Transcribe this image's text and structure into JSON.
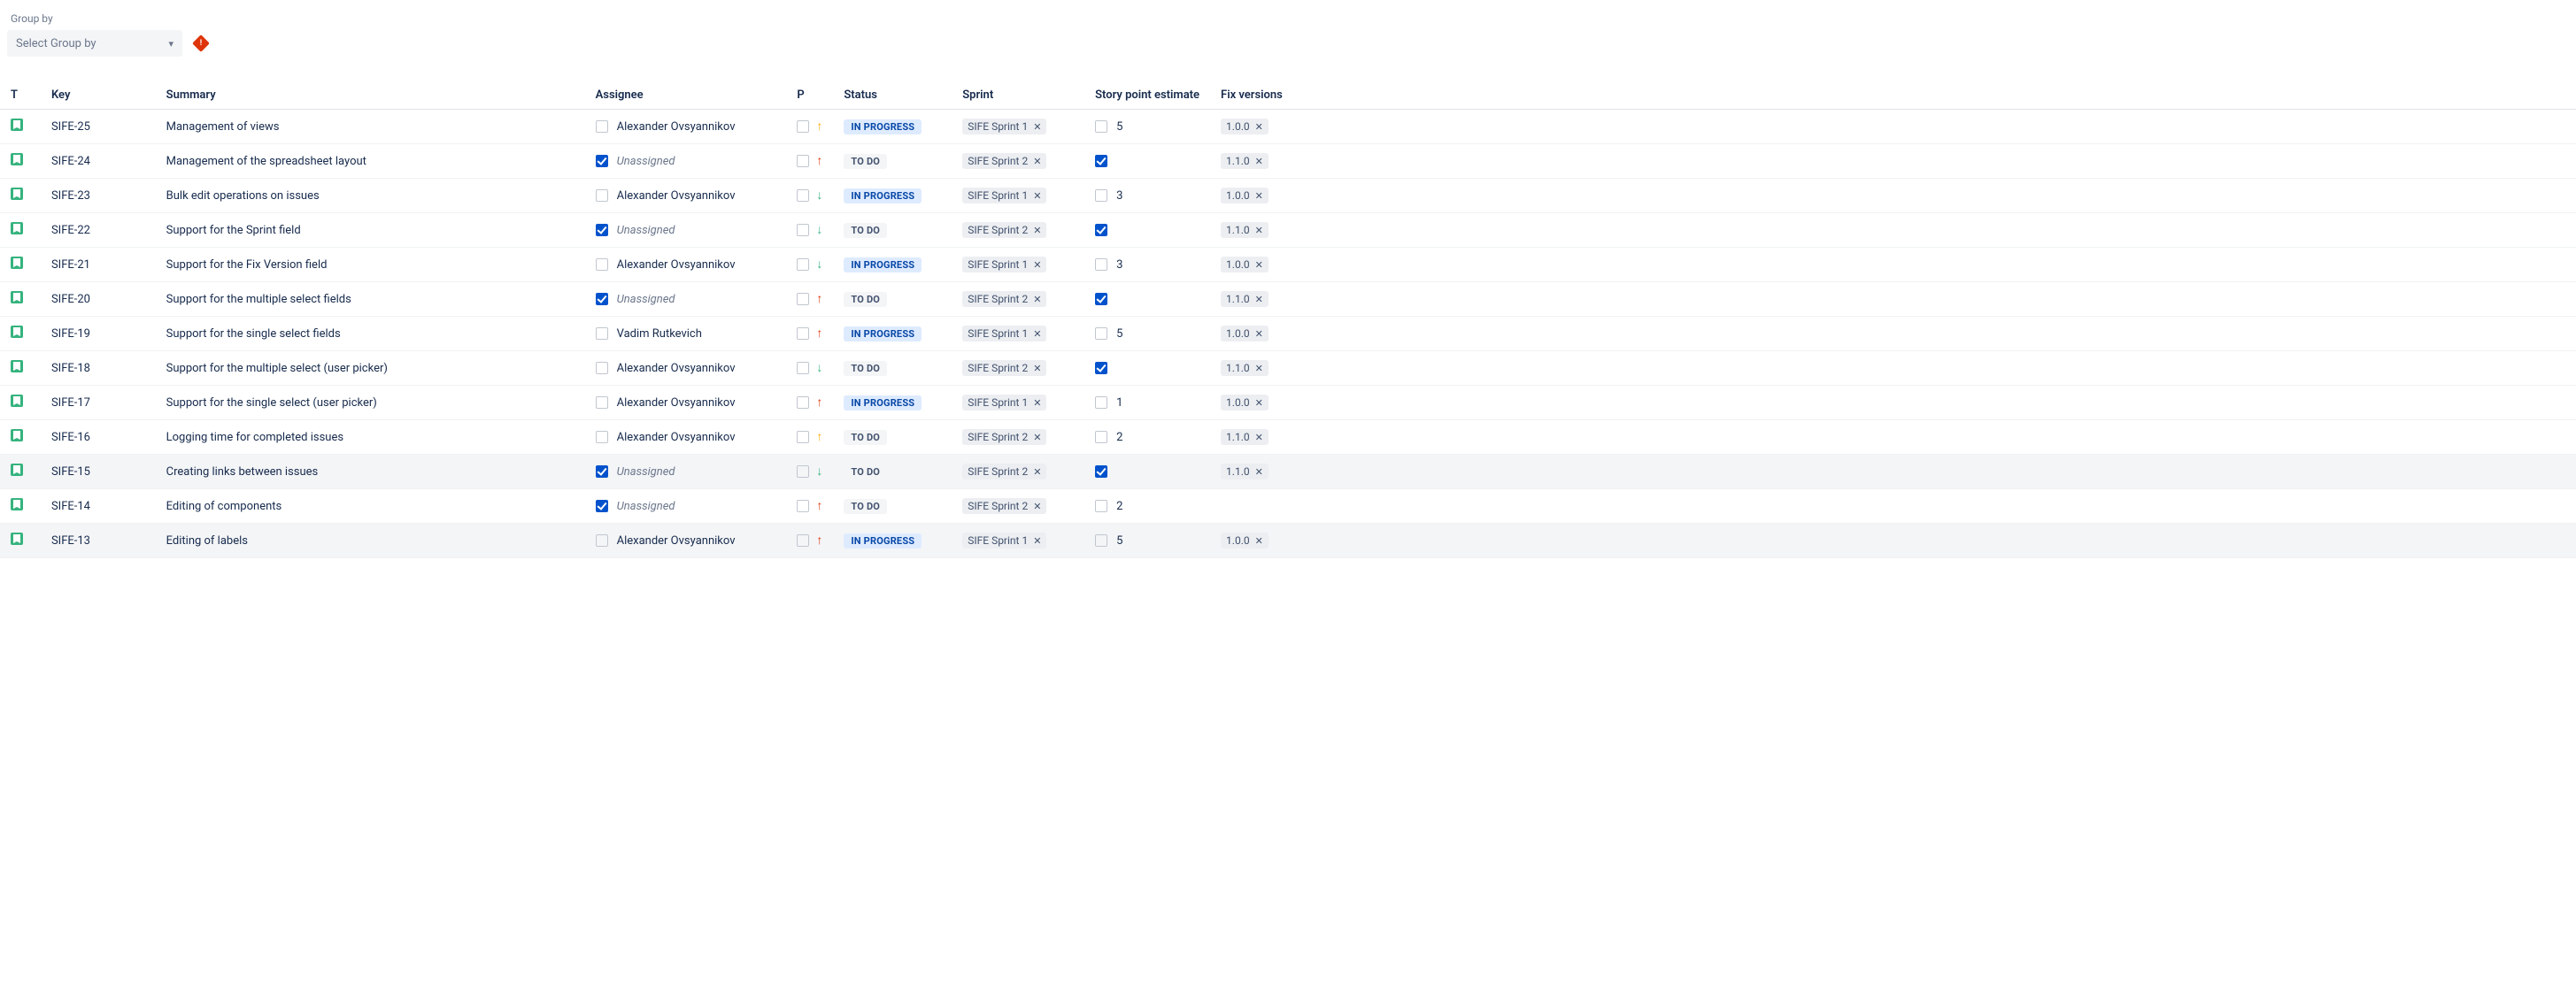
{
  "groupBy": {
    "label": "Group by",
    "placeholder": "Select Group by"
  },
  "headers": {
    "type": "T",
    "key": "Key",
    "summary": "Summary",
    "assignee": "Assignee",
    "priority": "P",
    "status": "Status",
    "sprint": "Sprint",
    "spe": "Story point estimate",
    "fixVersions": "Fix versions"
  },
  "priorityGlyph": {
    "up": "↑",
    "down": "↓"
  },
  "statusLabels": {
    "TO_DO": "TO DO",
    "IN_PROGRESS": "IN PROGRESS"
  },
  "rows": [
    {
      "key": "SIFE-25",
      "summary": "Management of views",
      "assignee": "Alexander Ovsyannikov",
      "assigneeChecked": false,
      "priority": "medium_up",
      "status": "IN_PROGRESS",
      "sprint": "SIFE Sprint 1",
      "spe": "5",
      "speChecked": false,
      "fixVersion": "1.0.0",
      "highlight": false
    },
    {
      "key": "SIFE-24",
      "summary": "Management of the spreadsheet layout",
      "assignee": "Unassigned",
      "assigneeChecked": true,
      "priority": "high_up",
      "status": "TO_DO",
      "sprint": "SIFE Sprint 2",
      "spe": "",
      "speChecked": true,
      "fixVersion": "1.1.0",
      "highlight": false
    },
    {
      "key": "SIFE-23",
      "summary": "Bulk edit operations on issues",
      "assignee": "Alexander Ovsyannikov",
      "assigneeChecked": false,
      "priority": "lowest_down",
      "status": "IN_PROGRESS",
      "sprint": "SIFE Sprint 1",
      "spe": "3",
      "speChecked": false,
      "fixVersion": "1.0.0",
      "highlight": false
    },
    {
      "key": "SIFE-22",
      "summary": "Support for the Sprint field",
      "assignee": "Unassigned",
      "assigneeChecked": true,
      "priority": "lowest_down",
      "status": "TO_DO",
      "sprint": "SIFE Sprint 2",
      "spe": "",
      "speChecked": true,
      "fixVersion": "1.1.0",
      "highlight": false
    },
    {
      "key": "SIFE-21",
      "summary": "Support for the Fix Version field",
      "assignee": "Alexander Ovsyannikov",
      "assigneeChecked": false,
      "priority": "lowest_down",
      "status": "IN_PROGRESS",
      "sprint": "SIFE Sprint 1",
      "spe": "3",
      "speChecked": false,
      "fixVersion": "1.0.0",
      "highlight": false
    },
    {
      "key": "SIFE-20",
      "summary": "Support for the multiple select fields",
      "assignee": "Unassigned",
      "assigneeChecked": true,
      "priority": "high_up",
      "status": "TO_DO",
      "sprint": "SIFE Sprint 2",
      "spe": "",
      "speChecked": true,
      "fixVersion": "1.1.0",
      "highlight": false
    },
    {
      "key": "SIFE-19",
      "summary": "Support for the single select fields",
      "assignee": "Vadim Rutkevich",
      "assigneeChecked": false,
      "priority": "high_up",
      "status": "IN_PROGRESS",
      "sprint": "SIFE Sprint 1",
      "spe": "5",
      "speChecked": false,
      "fixVersion": "1.0.0",
      "highlight": false
    },
    {
      "key": "SIFE-18",
      "summary": "Support for the multiple select (user picker)",
      "assignee": "Alexander Ovsyannikov",
      "assigneeChecked": false,
      "priority": "lowest_down",
      "status": "TO_DO",
      "sprint": "SIFE Sprint 2",
      "spe": "",
      "speChecked": true,
      "fixVersion": "1.1.0",
      "highlight": false
    },
    {
      "key": "SIFE-17",
      "summary": "Support for the single select (user picker)",
      "assignee": "Alexander Ovsyannikov",
      "assigneeChecked": false,
      "priority": "high_up",
      "status": "IN_PROGRESS",
      "sprint": "SIFE Sprint 1",
      "spe": "1",
      "speChecked": false,
      "fixVersion": "1.0.0",
      "highlight": false
    },
    {
      "key": "SIFE-16",
      "summary": "Logging time for completed issues",
      "assignee": "Alexander Ovsyannikov",
      "assigneeChecked": false,
      "priority": "medium_up",
      "status": "TO_DO",
      "sprint": "SIFE Sprint 2",
      "spe": "2",
      "speChecked": false,
      "fixVersion": "1.1.0",
      "highlight": false
    },
    {
      "key": "SIFE-15",
      "summary": "Creating links between issues",
      "assignee": "Unassigned",
      "assigneeChecked": true,
      "priority": "lowest_down",
      "status": "TO_DO",
      "sprint": "SIFE Sprint 2",
      "spe": "",
      "speChecked": true,
      "fixVersion": "1.1.0",
      "highlight": true
    },
    {
      "key": "SIFE-14",
      "summary": "Editing of components",
      "assignee": "Unassigned",
      "assigneeChecked": true,
      "priority": "high_up",
      "status": "TO_DO",
      "sprint": "SIFE Sprint 2",
      "spe": "2",
      "speChecked": false,
      "fixVersion": "",
      "highlight": false
    },
    {
      "key": "SIFE-13",
      "summary": "Editing of labels",
      "assignee": "Alexander Ovsyannikov",
      "assigneeChecked": false,
      "priority": "high_up",
      "status": "IN_PROGRESS",
      "sprint": "SIFE Sprint 1",
      "spe": "5",
      "speChecked": false,
      "fixVersion": "1.0.0",
      "highlight": true
    }
  ]
}
